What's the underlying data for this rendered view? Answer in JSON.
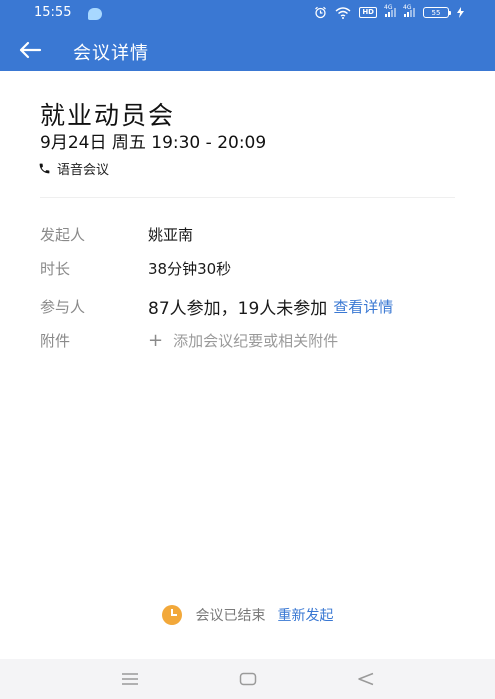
{
  "status_bar": {
    "time": "15:55",
    "hd_label": "HD",
    "signal1_label": "4G",
    "signal2_label": "4G",
    "battery": "55"
  },
  "header": {
    "title": "会议详情"
  },
  "meeting": {
    "title": "就业动员会",
    "time": "9月24日 周五 19:30 - 20:09",
    "type": "语音会议"
  },
  "details": {
    "initiator_label": "发起人",
    "initiator_value": "姚亚南",
    "duration_label": "时长",
    "duration_value": "38分钟30秒",
    "participants_label": "参与人",
    "participants_value": "87人参加，19人未参加",
    "participants_link": "查看详情",
    "attachments_label": "附件",
    "attachments_plus": "+",
    "attachments_value": "添加会议纪要或相关附件"
  },
  "footer": {
    "status_text": "会议已结束",
    "restart_label": "重新发起"
  },
  "colors": {
    "header_bg": "#3a78d3",
    "link": "#3a78d3",
    "clock": "#f2a83a"
  }
}
